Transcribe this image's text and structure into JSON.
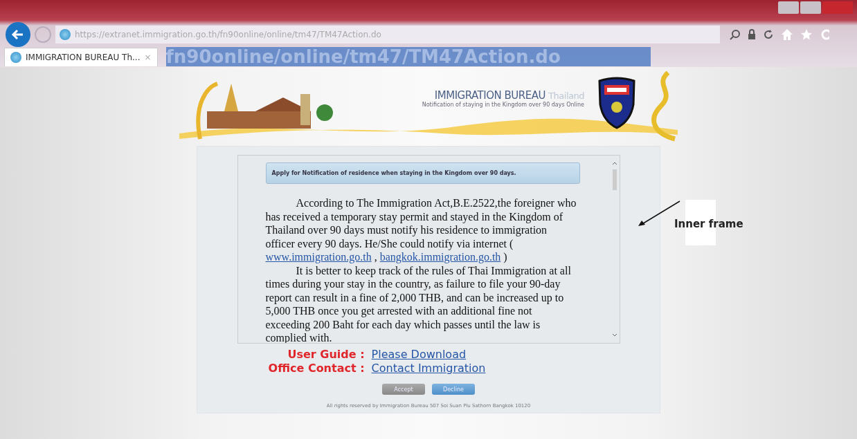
{
  "browser": {
    "url": "https://extranet.immigration.go.th/fn90online/online/tm47/TM47Action.do",
    "tabs": [
      {
        "label": "IMMIGRATION BUREAU Th...",
        "selected": true,
        "close_glyph": "×"
      }
    ],
    "tab_strip_text": "fn90online/online/tm47/TM47Action.do"
  },
  "banner": {
    "title": "IMMIGRATION BUREAU",
    "title_suffix": "Thailand",
    "subtitle": "Notification of staying in the Kingdom over 90 days Online"
  },
  "notice": {
    "heading": "Apply for Notification of residence when staying in the Kingdom over 90 days.",
    "paragraph_1": {
      "text": "According to The Immigration Act,B.E.2522,the foreigner who has received a temporary stay permit and stayed in the Kingdom of Thailand over 90 days must notify his residence to immigration officer every 90 days. He/She could notify via internet ( ",
      "links": [
        "www.immigration.go.th",
        "bangkok.immigration.go.th"
      ],
      "separator": " , ",
      "closing": " )"
    },
    "paragraph_2": "It is better to keep track of the rules of Thai Immigration at all times during your stay in the country, as failure to file your 90-day report can result in a fine of 2,000 THB, and can be increased up to 5,000 THB once you get arrested with an additional fine not exceeding 200 Baht for each day which passes until the law is complied with."
  },
  "contacts": [
    {
      "label": "User Guide :",
      "link": "Please Download"
    },
    {
      "label": "Office Contact :",
      "link": "Contact Immigration"
    }
  ],
  "buttons": [
    {
      "label": "Accept",
      "kind": "grey"
    },
    {
      "label": "Decline",
      "kind": "blue"
    }
  ],
  "footer": "All rights reserved by Immigration Bureau 507 Soi Suan Plu Sathorn Bangkok 10120",
  "annotation": {
    "text": "Inner frame"
  }
}
